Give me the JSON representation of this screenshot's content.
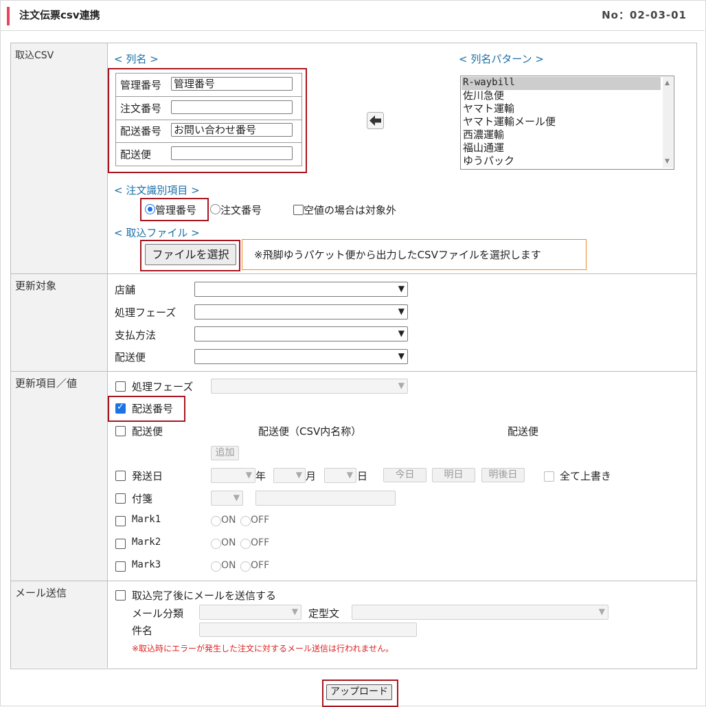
{
  "header": {
    "title": "注文伝票csv連携",
    "screen_no": "No：02-03-01"
  },
  "rows": {
    "import_csv": "取込CSV",
    "update_target": "更新対象",
    "update_items": "更新項目／値",
    "mail": "メール送信"
  },
  "import": {
    "column_heading": "< 列名 >",
    "pattern_heading": "< 列名パターン >",
    "columns": [
      {
        "label": "管理番号",
        "value": "管理番号"
      },
      {
        "label": "注文番号",
        "value": ""
      },
      {
        "label": "配送番号",
        "value": "お問い合わせ番号"
      },
      {
        "label": "配送便",
        "value": ""
      }
    ],
    "patterns": [
      "R-waybill",
      "佐川急便",
      "ヤマト運輸",
      "ヤマト運輸メール便",
      "西濃運輸",
      "福山通運",
      "ゆうパック"
    ],
    "selected_pattern": "R-waybill",
    "order_id_heading": "< 注文識別項目 >",
    "order_id_options": [
      "管理番号",
      "注文番号"
    ],
    "order_id_selected": "管理番号",
    "skip_empty_label": "空値の場合は対象外",
    "file_heading": "< 取込ファイル >",
    "file_button": "ファイルを選択",
    "file_note": "※飛脚ゆうパケット便から出力したCSVファイルを選択します"
  },
  "target": {
    "store": "店舗",
    "phase": "処理フェーズ",
    "payment": "支払方法",
    "delivery": "配送便"
  },
  "items": {
    "phase": "処理フェーズ",
    "tracking": "配送番号",
    "tracking_checked": true,
    "delivery": "配送便",
    "delivery_csv_name": "配送便（CSV内名称）",
    "delivery_col2": "配送便",
    "add_button": "追加",
    "ship_date": "発送日",
    "year": "年",
    "month": "月",
    "day": "日",
    "today": "今日",
    "tomorrow": "明日",
    "day_after": "明後日",
    "overwrite_all": "全て上書き",
    "tag": "付箋",
    "marks": [
      "Mark1",
      "Mark2",
      "Mark3"
    ],
    "on": "ON",
    "off": "OFF"
  },
  "mail": {
    "send_after": "取込完了後にメールを送信する",
    "category": "メール分類",
    "template": "定型文",
    "subject": "件名",
    "error_note": "※取込時にエラーが発生した注文に対するメール送信は行われません。"
  },
  "upload_button": "アップロード",
  "colors": {
    "accent": "#e8445a",
    "highlight_box": "#a8141e",
    "note_box": "#f08a24",
    "link_blue": "#1a6fa8",
    "error_red": "#e02020",
    "check_blue": "#1a73e8"
  }
}
